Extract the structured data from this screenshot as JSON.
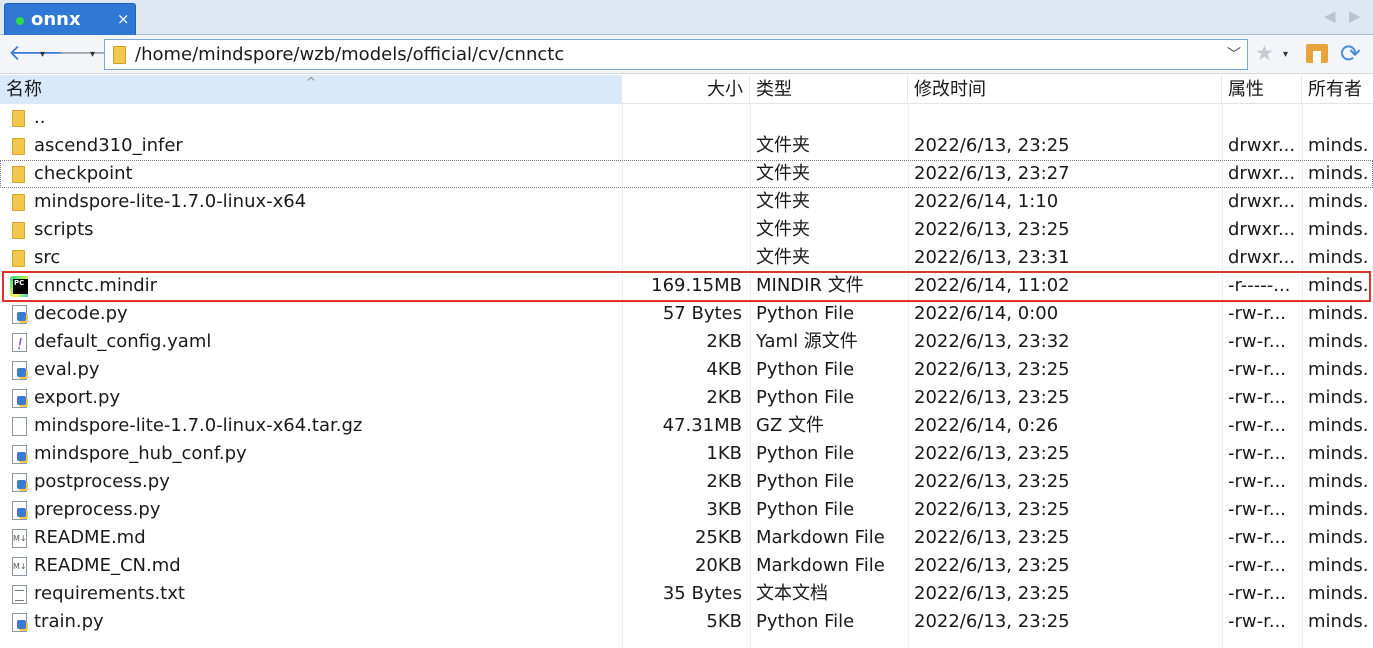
{
  "tab": {
    "title": "onnx",
    "close": "×",
    "status_color": "#2ddc44"
  },
  "tab_nav": {
    "prev": "◀",
    "next": "▶"
  },
  "toolbar": {
    "back": "🡐",
    "forward": "🡒",
    "address": "/home/mindspore/wzb/models/official/cv/cnnctc",
    "dropdown": "▾",
    "address_chevron": "﹀",
    "bookmark": "★",
    "refresh": "⟳"
  },
  "header": {
    "name": "名称",
    "size": "大小",
    "type": "类型",
    "modified": "修改时间",
    "attributes": "属性",
    "owner": "所有者",
    "sort_indicator": "^"
  },
  "files": [
    {
      "icon": "folder-icon",
      "name": "..",
      "size": "",
      "type": "",
      "modified": "",
      "attr": "",
      "owner": ""
    },
    {
      "icon": "folder-icon",
      "name": "ascend310_infer",
      "size": "",
      "type": "文件夹",
      "modified": "2022/6/13, 23:25",
      "attr": "drwxr...",
      "owner": "minds..."
    },
    {
      "icon": "folder-icon",
      "name": "checkpoint",
      "size": "",
      "type": "文件夹",
      "modified": "2022/6/13, 23:27",
      "attr": "drwxr...",
      "owner": "minds..."
    },
    {
      "icon": "folder-icon",
      "name": "mindspore-lite-1.7.0-linux-x64",
      "size": "",
      "type": "文件夹",
      "modified": "2022/6/14, 1:10",
      "attr": "drwxr...",
      "owner": "minds..."
    },
    {
      "icon": "folder-icon",
      "name": "scripts",
      "size": "",
      "type": "文件夹",
      "modified": "2022/6/13, 23:25",
      "attr": "drwxr...",
      "owner": "minds..."
    },
    {
      "icon": "folder-icon",
      "name": "src",
      "size": "",
      "type": "文件夹",
      "modified": "2022/6/13, 23:31",
      "attr": "drwxr...",
      "owner": "minds..."
    },
    {
      "icon": "pycharm-icon",
      "name": "cnnctc.mindir",
      "size": "169.15MB",
      "type": "MINDIR 文件",
      "modified": "2022/6/14, 11:02",
      "attr": "-r-----...",
      "owner": "minds..."
    },
    {
      "icon": "python-file-icon",
      "name": "decode.py",
      "size": "57 Bytes",
      "type": "Python File",
      "modified": "2022/6/14, 0:00",
      "attr": "-rw-r...",
      "owner": "minds..."
    },
    {
      "icon": "yaml-file-icon",
      "name": "default_config.yaml",
      "size": "2KB",
      "type": "Yaml 源文件",
      "modified": "2022/6/13, 23:32",
      "attr": "-rw-r...",
      "owner": "minds..."
    },
    {
      "icon": "python-file-icon",
      "name": "eval.py",
      "size": "4KB",
      "type": "Python File",
      "modified": "2022/6/13, 23:25",
      "attr": "-rw-r...",
      "owner": "minds..."
    },
    {
      "icon": "python-file-icon",
      "name": "export.py",
      "size": "2KB",
      "type": "Python File",
      "modified": "2022/6/13, 23:25",
      "attr": "-rw-r...",
      "owner": "minds..."
    },
    {
      "icon": "blank-file-icon",
      "name": "mindspore-lite-1.7.0-linux-x64.tar.gz",
      "size": "47.31MB",
      "type": "GZ 文件",
      "modified": "2022/6/14, 0:26",
      "attr": "-rw-r...",
      "owner": "minds..."
    },
    {
      "icon": "python-file-icon",
      "name": "mindspore_hub_conf.py",
      "size": "1KB",
      "type": "Python File",
      "modified": "2022/6/13, 23:25",
      "attr": "-rw-r...",
      "owner": "minds..."
    },
    {
      "icon": "python-file-icon",
      "name": "postprocess.py",
      "size": "2KB",
      "type": "Python File",
      "modified": "2022/6/13, 23:25",
      "attr": "-rw-r...",
      "owner": "minds..."
    },
    {
      "icon": "python-file-icon",
      "name": "preprocess.py",
      "size": "3KB",
      "type": "Python File",
      "modified": "2022/6/13, 23:25",
      "attr": "-rw-r...",
      "owner": "minds..."
    },
    {
      "icon": "markdown-file-icon",
      "name": "README.md",
      "size": "25KB",
      "type": "Markdown File",
      "modified": "2022/6/13, 23:25",
      "attr": "-rw-r...",
      "owner": "minds..."
    },
    {
      "icon": "markdown-file-icon",
      "name": "README_CN.md",
      "size": "20KB",
      "type": "Markdown File",
      "modified": "2022/6/13, 23:25",
      "attr": "-rw-r...",
      "owner": "minds..."
    },
    {
      "icon": "text-file-icon",
      "name": "requirements.txt",
      "size": "35 Bytes",
      "type": "文本文档",
      "modified": "2022/6/13, 23:25",
      "attr": "-rw-r...",
      "owner": "minds..."
    },
    {
      "icon": "python-file-icon",
      "name": "train.py",
      "size": "5KB",
      "type": "Python File",
      "modified": "2022/6/13, 23:25",
      "attr": "-rw-r...",
      "owner": "minds..."
    }
  ],
  "focused_row": 2,
  "highlighted_row": 6,
  "colors": {
    "tab": "#2f78d6",
    "highlight_border": "#e0332c",
    "sorted_header": "#d9e9f9"
  }
}
